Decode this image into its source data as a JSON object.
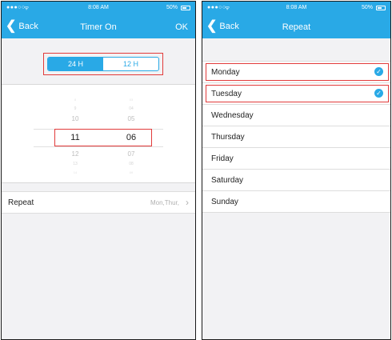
{
  "left_screen": {
    "status": {
      "signal": "●●●○○",
      "wifi": "ᯤ",
      "time": "8:08 AM",
      "battery": "50%"
    },
    "nav": {
      "back_label": "Back",
      "title": "Timer On",
      "ok_label": "OK"
    },
    "format_toggle": {
      "options": [
        "24 H",
        "12 H"
      ],
      "selected": "24 H"
    },
    "picker": {
      "hours": [
        "8",
        "9",
        "10",
        "11",
        "12",
        "13",
        "14"
      ],
      "minutes": [
        "03",
        "04",
        "05",
        "06",
        "07",
        "08",
        "09"
      ],
      "selected_hour": "11",
      "selected_minute": "06"
    },
    "repeat": {
      "label": "Repeat",
      "value": "Mon,Thur,"
    }
  },
  "right_screen": {
    "status": {
      "signal": "●●●○○",
      "wifi": "ᯤ",
      "time": "8:08 AM",
      "battery": "50%"
    },
    "nav": {
      "back_label": "Back",
      "title": "Repeat"
    },
    "days": [
      {
        "label": "Monday",
        "checked": true
      },
      {
        "label": "Tuesday",
        "checked": true
      },
      {
        "label": "Wednesday",
        "checked": false
      },
      {
        "label": "Thursday",
        "checked": false
      },
      {
        "label": "Friday",
        "checked": false
      },
      {
        "label": "Saturday",
        "checked": false
      },
      {
        "label": "Sunday",
        "checked": false
      }
    ]
  },
  "colors": {
    "accent": "#29a9e6",
    "highlight_box": "#e23b3b"
  }
}
